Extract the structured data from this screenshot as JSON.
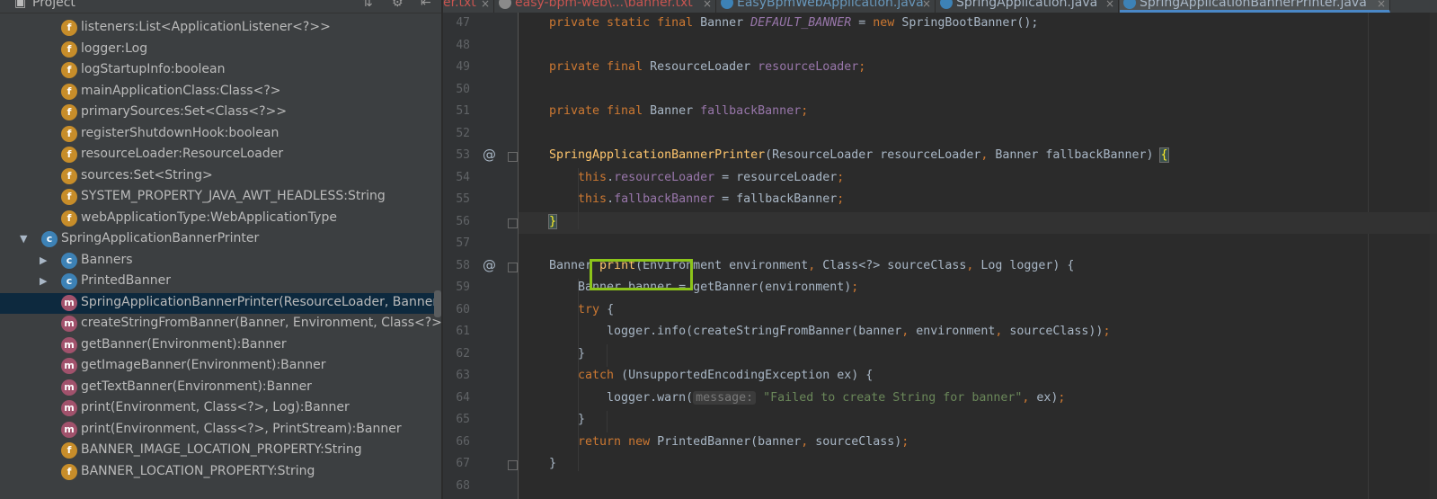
{
  "project_panel": {
    "title": "Project",
    "header_icons": [
      "collapse-icon",
      "gear-icon",
      "hide-icon"
    ],
    "tree": [
      {
        "icon": "field-icon",
        "icon_letter": "f",
        "label": "listeners:List<ApplicationListener<?>>"
      },
      {
        "icon": "field-icon",
        "icon_letter": "f",
        "label": "logger:Log"
      },
      {
        "icon": "field-icon",
        "icon_letter": "f",
        "label": "logStartupInfo:boolean"
      },
      {
        "icon": "field-icon",
        "icon_letter": "f",
        "label": "mainApplicationClass:Class<?>"
      },
      {
        "icon": "field-icon",
        "icon_letter": "f",
        "label": "primarySources:Set<Class<?>>"
      },
      {
        "icon": "field-icon",
        "icon_letter": "f",
        "label": "registerShutdownHook:boolean"
      },
      {
        "icon": "field-icon",
        "icon_letter": "f",
        "label": "resourceLoader:ResourceLoader"
      },
      {
        "icon": "field-icon",
        "icon_letter": "f",
        "label": "sources:Set<String>"
      },
      {
        "icon": "field-icon",
        "icon_letter": "f",
        "label": "SYSTEM_PROPERTY_JAVA_AWT_HEADLESS:String"
      },
      {
        "icon": "field-icon",
        "icon_letter": "f",
        "label": "webApplicationType:WebApplicationType"
      },
      {
        "icon": "class-icon",
        "icon_letter": "c",
        "label": "SpringApplicationBannerPrinter",
        "arrow": "▼"
      },
      {
        "icon": "class-icon",
        "icon_letter": "c",
        "label": "Banners",
        "arrow": "▶"
      },
      {
        "icon": "class-icon",
        "icon_letter": "c",
        "label": "PrintedBanner",
        "arrow": "▶"
      },
      {
        "icon": "method-icon",
        "icon_letter": "m",
        "label": "SpringApplicationBannerPrinter(ResourceLoader, Banner)",
        "selected": true
      },
      {
        "icon": "method-icon",
        "icon_letter": "m",
        "label": "createStringFromBanner(Banner, Environment, Class<?>):Strin"
      },
      {
        "icon": "method-icon",
        "icon_letter": "m",
        "label": "getBanner(Environment):Banner"
      },
      {
        "icon": "method-icon",
        "icon_letter": "m",
        "label": "getImageBanner(Environment):Banner"
      },
      {
        "icon": "method-icon",
        "icon_letter": "m",
        "label": "getTextBanner(Environment):Banner"
      },
      {
        "icon": "method-icon",
        "icon_letter": "m",
        "label": "print(Environment, Class<?>, Log):Banner"
      },
      {
        "icon": "method-icon",
        "icon_letter": "m",
        "label": "print(Environment, Class<?>, PrintStream):Banner"
      },
      {
        "icon": "field-icon",
        "icon_letter": "f",
        "label": "BANNER_IMAGE_LOCATION_PROPERTY:String"
      },
      {
        "icon": "field-icon",
        "icon_letter": "f",
        "label": "BANNER_LOCATION_PROPERTY:String"
      }
    ]
  },
  "tabs": [
    {
      "label": "er.txt",
      "active": false,
      "modified_color": "#c75450"
    },
    {
      "label": "easy-bpm-web\\...\\banner.txt",
      "active": false,
      "modified_color": "#c75450"
    },
    {
      "label": "EasyBpmWebApplication.java",
      "active": false,
      "modified_color": "#6897bb"
    },
    {
      "label": "SpringApplication.java",
      "active": false,
      "modified_color": "#a9b7c6"
    },
    {
      "label": "SpringApplicationBannerPrinter.java",
      "active": true,
      "modified_color": "#a9b7c6"
    }
  ],
  "tab_close_glyph": "×",
  "editor": {
    "lines": [
      {
        "num": "47",
        "tokens": [
          [
            "kw",
            "private static final "
          ],
          [
            "",
            "Banner "
          ],
          [
            "sfld",
            "DEFAULT_BANNER"
          ],
          [
            "",
            " = "
          ],
          [
            "kw",
            "new "
          ],
          [
            "",
            "SpringBootBanner();"
          ]
        ]
      },
      {
        "num": "48",
        "tokens": []
      },
      {
        "num": "49",
        "tokens": [
          [
            "kw",
            "private final "
          ],
          [
            "",
            "ResourceLoader "
          ],
          [
            "fld",
            "resourceLoader"
          ],
          [
            "kw",
            ";"
          ]
        ]
      },
      {
        "num": "50",
        "tokens": []
      },
      {
        "num": "51",
        "tokens": [
          [
            "kw",
            "private final "
          ],
          [
            "",
            "Banner "
          ],
          [
            "fld",
            "fallbackBanner"
          ],
          [
            "kw",
            ";"
          ]
        ]
      },
      {
        "num": "52",
        "tokens": []
      },
      {
        "num": "53",
        "at": "@",
        "tokens": [
          [
            "fn",
            "SpringApplicationBannerPrinter"
          ],
          [
            "",
            "(ResourceLoader resourceLoader"
          ],
          [
            "kw",
            ", "
          ],
          [
            "",
            "Banner fallbackBanner) "
          ],
          [
            "brace-hl",
            "{"
          ]
        ]
      },
      {
        "num": "54",
        "tokens": [
          [
            "",
            "    "
          ],
          [
            "kw",
            "this"
          ],
          [
            "",
            "."
          ],
          [
            "fld",
            "resourceLoader"
          ],
          [
            "",
            " = resourceLoader"
          ],
          [
            "kw",
            ";"
          ]
        ]
      },
      {
        "num": "55",
        "tokens": [
          [
            "",
            "    "
          ],
          [
            "kw",
            "this"
          ],
          [
            "",
            "."
          ],
          [
            "fld",
            "fallbackBanner"
          ],
          [
            "",
            " = fallbackBanner"
          ],
          [
            "kw",
            ";"
          ]
        ]
      },
      {
        "num": "56",
        "caret": true,
        "tokens": [
          [
            "brace-hl",
            "}"
          ]
        ]
      },
      {
        "num": "57",
        "tokens": []
      },
      {
        "num": "58",
        "at": "@",
        "tokens": [
          [
            "",
            "Banner "
          ],
          [
            "fn",
            "print"
          ],
          [
            "",
            "(Environment environment"
          ],
          [
            "kw",
            ", "
          ],
          [
            "",
            "Class<?> sourceClass"
          ],
          [
            "kw",
            ", "
          ],
          [
            "",
            "Log logger) {"
          ]
        ]
      },
      {
        "num": "59",
        "tokens": [
          [
            "",
            "    Banner banner = getBanner(environment)"
          ],
          [
            "kw",
            ";"
          ]
        ]
      },
      {
        "num": "60",
        "tokens": [
          [
            "",
            "    "
          ],
          [
            "kw",
            "try "
          ],
          [
            "",
            "{"
          ]
        ]
      },
      {
        "num": "61",
        "tokens": [
          [
            "",
            "        logger.info(createStringFromBanner(banner"
          ],
          [
            "kw",
            ", "
          ],
          [
            "",
            "environment"
          ],
          [
            "kw",
            ", "
          ],
          [
            "",
            "sourceClass))"
          ],
          [
            "kw",
            ";"
          ]
        ]
      },
      {
        "num": "62",
        "tokens": [
          [
            "",
            "    }"
          ]
        ]
      },
      {
        "num": "63",
        "tokens": [
          [
            "",
            "    "
          ],
          [
            "kw",
            "catch "
          ],
          [
            "",
            "(UnsupportedEncodingException ex) {"
          ]
        ]
      },
      {
        "num": "64",
        "tokens": [
          [
            "",
            "        logger.warn("
          ],
          [
            "hint",
            "message:"
          ],
          [
            "str",
            " \"Failed to create String for banner\""
          ],
          [
            "kw",
            ", "
          ],
          [
            "",
            "ex)"
          ],
          [
            "kw",
            ";"
          ]
        ]
      },
      {
        "num": "65",
        "tokens": [
          [
            "",
            "    }"
          ]
        ]
      },
      {
        "num": "66",
        "tokens": [
          [
            "",
            "    "
          ],
          [
            "kw",
            "return new "
          ],
          [
            "",
            "PrintedBanner(banner"
          ],
          [
            "kw",
            ", "
          ],
          [
            "",
            "sourceClass)"
          ],
          [
            "kw",
            ";"
          ]
        ]
      },
      {
        "num": "67",
        "tokens": [
          [
            "",
            "}"
          ]
        ]
      },
      {
        "num": "68",
        "tokens": []
      }
    ]
  }
}
